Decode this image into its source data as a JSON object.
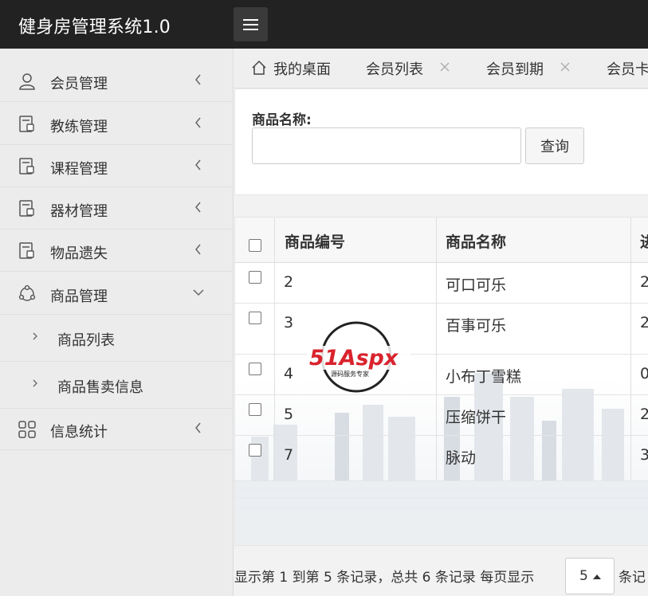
{
  "header": {
    "title": "健身房管理系统1.0"
  },
  "sidebar": {
    "items": [
      {
        "label": "会员管理"
      },
      {
        "label": "教练管理"
      },
      {
        "label": "课程管理"
      },
      {
        "label": "器材管理"
      },
      {
        "label": "物品遗失"
      },
      {
        "label": "商品管理"
      },
      {
        "label": "信息统计"
      }
    ],
    "sub_items": [
      {
        "label": "商品列表"
      },
      {
        "label": "商品售卖信息"
      }
    ]
  },
  "tabs": [
    {
      "label": "我的桌面"
    },
    {
      "label": "会员列表"
    },
    {
      "label": "会员到期"
    },
    {
      "label": "会员卡"
    }
  ],
  "search": {
    "label": "商品名称:",
    "value": "",
    "button": "查询"
  },
  "table": {
    "headers": [
      "商品编号",
      "商品名称",
      "进"
    ],
    "rows": [
      {
        "id": "2",
        "name": "可口可乐",
        "extra": "2"
      },
      {
        "id": "3",
        "name": "百事可乐",
        "extra": "2"
      },
      {
        "id": "4",
        "name": "小布丁雪糕",
        "extra": "0"
      },
      {
        "id": "5",
        "name": "压缩饼干",
        "extra": "2"
      },
      {
        "id": "7",
        "name": "脉动",
        "extra": "3"
      }
    ]
  },
  "watermark": {
    "brand": "51Aspx",
    "tagline": "源码服务专家"
  },
  "pagination": {
    "summary": "显示第 1 到第 5 条记录，总共 6 条记录 每页显示",
    "page_size": "5",
    "tail": "条记"
  },
  "colors": {
    "header_bg": "#222222",
    "sidebar_bg": "#ececec",
    "brand_red": "#d9232d"
  }
}
